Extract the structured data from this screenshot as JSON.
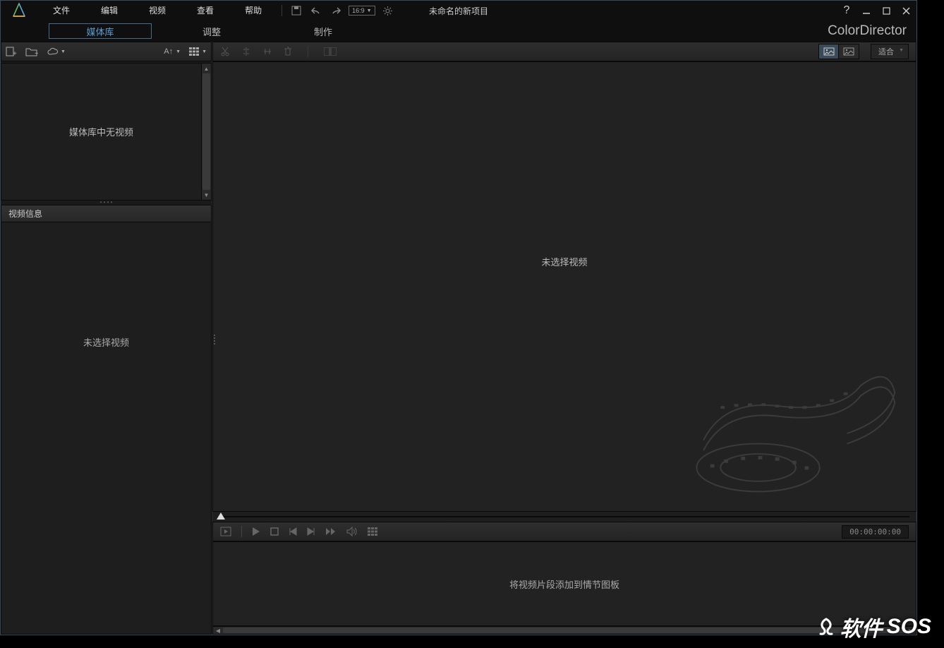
{
  "menu": {
    "file": "文件",
    "edit": "编辑",
    "video": "视频",
    "view": "查看",
    "help": "帮助"
  },
  "aspect_ratio_label": "16:9",
  "project_title": "未命名的新项目",
  "tabs": {
    "library": "媒体库",
    "adjust": "调整",
    "produce": "制作"
  },
  "brand": "ColorDirector",
  "left": {
    "media_empty": "媒体库中无视频",
    "info_title": "视频信息",
    "info_empty": "未选择视频"
  },
  "preview": {
    "empty": "未选择视频",
    "zoom_label": "适合"
  },
  "timecode": "00:00:00:00",
  "storyboard_empty": "将视频片段添加到情节图板",
  "watermark": {
    "text": "软件",
    "suffix": "SOS"
  }
}
